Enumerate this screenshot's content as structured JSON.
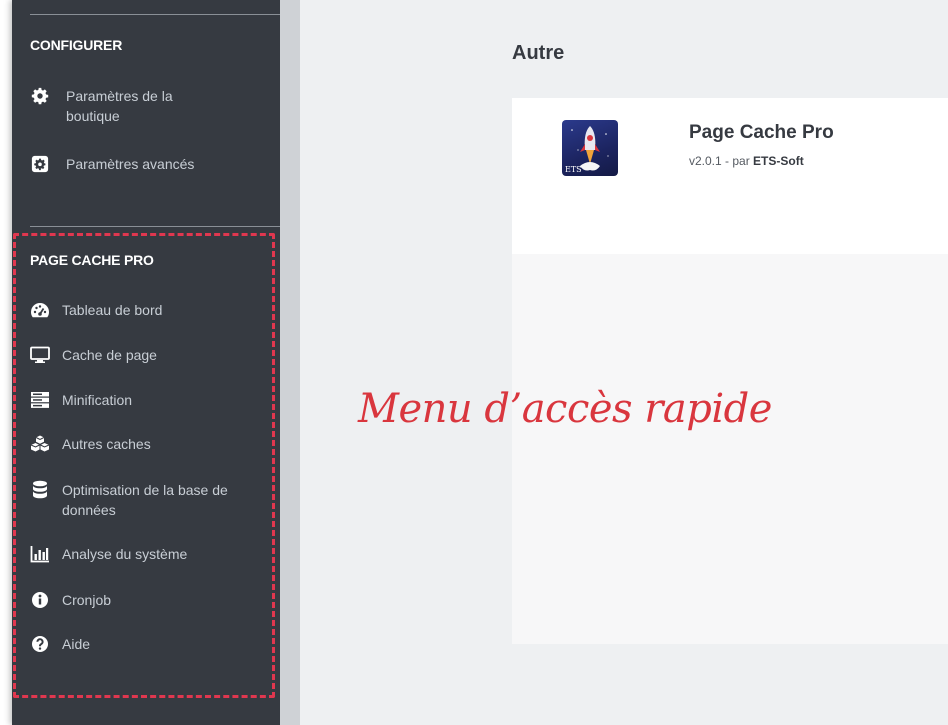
{
  "sidebar": {
    "configure": {
      "title": "CONFIGURER",
      "items": [
        {
          "label": "Paramètres de la boutique",
          "icon": "gear-icon"
        },
        {
          "label": "Paramètres avancés",
          "icon": "advanced-gear-icon"
        }
      ]
    },
    "page_cache_pro": {
      "title": "PAGE CACHE PRO",
      "items": [
        {
          "label": "Tableau de bord",
          "icon": "dashboard-icon"
        },
        {
          "label": "Cache de page",
          "icon": "monitor-icon"
        },
        {
          "label": "Minification",
          "icon": "server-icon"
        },
        {
          "label": "Autres caches",
          "icon": "cubes-icon"
        },
        {
          "label": "Optimisation de la base de données",
          "icon": "database-icon"
        },
        {
          "label": "Analyse du système",
          "icon": "bar-chart-icon"
        },
        {
          "label": "Cronjob",
          "icon": "info-icon"
        },
        {
          "label": "Aide",
          "icon": "question-icon"
        }
      ]
    }
  },
  "main": {
    "title": "Autre",
    "module": {
      "name": "Page Cache Pro",
      "version_prefix": "v2.0.1 - par ",
      "author": "ETS-Soft",
      "icon_text": "ETS"
    }
  },
  "annotation": {
    "text": "Menu d’accès rapide",
    "color": "#d9363e"
  },
  "colors": {
    "sidebar_bg": "#363a41",
    "main_bg": "#eef0f2",
    "accent_dashed": "#e0374f"
  }
}
